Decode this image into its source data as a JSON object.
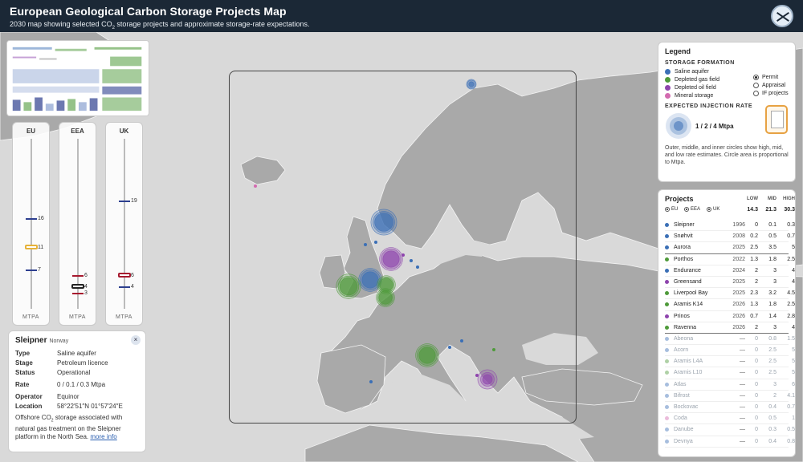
{
  "header": {
    "title": "European Geological Carbon Storage Projects Map",
    "subtitle_pre": "2030 map showing selected CO",
    "subtitle_sub": "2",
    "subtitle_post": " storage projects and approximate storage-rate expectations."
  },
  "sliders": [
    {
      "label": "EU",
      "footer": "MTPA",
      "values": {
        "high": "16",
        "mid": "11",
        "low": "7"
      },
      "levels": {
        "high": 16,
        "mid": 11,
        "low": 7
      },
      "color": "#2d3f8f",
      "mid_color": "#e6b23a"
    },
    {
      "label": "EEA",
      "footer": "MTPA",
      "values": {
        "high": "6",
        "mid": "4",
        "low": "3"
      },
      "levels": {
        "high": 6,
        "mid": 4,
        "low": 3
      },
      "color": "#a6192e",
      "mid_color": "#222222"
    },
    {
      "label": "UK",
      "footer": "MTPA",
      "values": {
        "high": "19",
        "mid": "6",
        "low": "4"
      },
      "levels": {
        "high": 19,
        "mid": 6,
        "low": 4
      },
      "color": "#2d3f8f",
      "mid_color": "#a6192e"
    }
  ],
  "slider_max": 30,
  "info": {
    "name": "Sleipner",
    "country": "Norway",
    "close": "×",
    "rows1": [
      {
        "k": "Type",
        "v": "Saline aquifer"
      },
      {
        "k": "Stage",
        "v": "Petroleum licence"
      },
      {
        "k": "Status",
        "v": "Operational"
      }
    ],
    "rate_k": "Rate",
    "rate_v": "0 / 0.1 / 0.3 Mtpa",
    "rows2": [
      {
        "k": "Operator",
        "v": "Equinor"
      },
      {
        "k": "Location",
        "v": "58°22′51″N 01°57′24″E"
      }
    ],
    "desc_pre": "Offshore CO",
    "desc_sub": "2",
    "desc_post": " storage associated with natural gas treatment on the Sleipner platform in the North Sea. ",
    "more": "more info"
  },
  "legend": {
    "title": "Legend",
    "formation_title": "STORAGE FORMATION",
    "formations": [
      {
        "label": "Saline aquifer",
        "color": "#3b6fb6"
      },
      {
        "label": "Depleted gas field",
        "color": "#4e9a3a"
      },
      {
        "label": "Depleted oil field",
        "color": "#8e44ad"
      },
      {
        "label": "Mineral storage",
        "color": "#d36bb0"
      }
    ],
    "stages": [
      {
        "label": "Permit",
        "on": true
      },
      {
        "label": "Appraisal",
        "on": false
      },
      {
        "label": "IF projects",
        "on": false
      }
    ],
    "rate_title": "EXPECTED INJECTION RATE",
    "rate_label": "1 / 2 / 4 Mtpa",
    "note": "Outer, middle, and inner circles show high, mid, and low rate estimates. Circle area is proportional to Mtpa."
  },
  "projects": {
    "title": "Projects",
    "cols": [
      "LOW",
      "MID",
      "HIGH"
    ],
    "filters": [
      "EU",
      "EEA",
      "UK"
    ],
    "totals": [
      "14.3",
      "21.3",
      "30.3"
    ],
    "rows": [
      {
        "name": "Sleipner",
        "year": "1996",
        "low": "0",
        "mid": "0.1",
        "high": "0.3",
        "color": "#3b6fb6",
        "faded": false,
        "sep": false
      },
      {
        "name": "Snøhvit",
        "year": "2008",
        "low": "0.2",
        "mid": "0.5",
        "high": "0.7",
        "color": "#3b6fb6",
        "faded": false,
        "sep": false
      },
      {
        "name": "Aurora",
        "year": "2025",
        "low": "2.5",
        "mid": "3.5",
        "high": "5",
        "color": "#3b6fb6",
        "faded": false,
        "sep": true
      },
      {
        "name": "Porthos",
        "year": "2022",
        "low": "1.3",
        "mid": "1.8",
        "high": "2.5",
        "color": "#4e9a3a",
        "faded": false,
        "sep": false
      },
      {
        "name": "Endurance",
        "year": "2024",
        "low": "2",
        "mid": "3",
        "high": "4",
        "color": "#3b6fb6",
        "faded": false,
        "sep": false
      },
      {
        "name": "Greensand",
        "year": "2025",
        "low": "2",
        "mid": "3",
        "high": "4",
        "color": "#8e44ad",
        "faded": false,
        "sep": false
      },
      {
        "name": "Liverpool Bay",
        "year": "2025",
        "low": "2.3",
        "mid": "3.2",
        "high": "4.5",
        "color": "#4e9a3a",
        "faded": false,
        "sep": false
      },
      {
        "name": "Aramis K14",
        "year": "2026",
        "low": "1.3",
        "mid": "1.8",
        "high": "2.5",
        "color": "#4e9a3a",
        "faded": false,
        "sep": false
      },
      {
        "name": "Prinos",
        "year": "2026",
        "low": "0.7",
        "mid": "1.4",
        "high": "2.8",
        "color": "#8e44ad",
        "faded": false,
        "sep": false
      },
      {
        "name": "Ravenna",
        "year": "2026",
        "low": "2",
        "mid": "3",
        "high": "4",
        "color": "#4e9a3a",
        "faded": false,
        "sep": true
      },
      {
        "name": "Abeona",
        "year": "—",
        "low": "0",
        "mid": "0.8",
        "high": "1.5",
        "color": "#3b6fb6",
        "faded": true,
        "sep": false
      },
      {
        "name": "Acorn",
        "year": "—",
        "low": "0",
        "mid": "2.5",
        "high": "5",
        "color": "#3b6fb6",
        "faded": true,
        "sep": false
      },
      {
        "name": "Aramis L4A",
        "year": "—",
        "low": "0",
        "mid": "2.5",
        "high": "5",
        "color": "#4e9a3a",
        "faded": true,
        "sep": false
      },
      {
        "name": "Aramis L10",
        "year": "—",
        "low": "0",
        "mid": "2.5",
        "high": "5",
        "color": "#4e9a3a",
        "faded": true,
        "sep": false
      },
      {
        "name": "Atlas",
        "year": "—",
        "low": "0",
        "mid": "3",
        "high": "6",
        "color": "#3b6fb6",
        "faded": true,
        "sep": false
      },
      {
        "name": "Bifrost",
        "year": "—",
        "low": "0",
        "mid": "2",
        "high": "4.1",
        "color": "#3b6fb6",
        "faded": true,
        "sep": false
      },
      {
        "name": "Bockovac",
        "year": "—",
        "low": "0",
        "mid": "0.4",
        "high": "0.7",
        "color": "#3b6fb6",
        "faded": true,
        "sep": false
      },
      {
        "name": "Coda",
        "year": "—",
        "low": "0",
        "mid": "0.5",
        "high": "1",
        "color": "#d36bb0",
        "faded": true,
        "sep": false
      },
      {
        "name": "Danube",
        "year": "—",
        "low": "0",
        "mid": "0.3",
        "high": "0.5",
        "color": "#3b6fb6",
        "faded": true,
        "sep": false
      },
      {
        "name": "Devnya",
        "year": "—",
        "low": "0",
        "mid": "0.4",
        "high": "0.8",
        "color": "#3b6fb6",
        "faded": true,
        "sep": false
      }
    ]
  },
  "map": {
    "land": "#a9a9a9",
    "sea": "#d9d9d9",
    "bubbles": [
      {
        "name": "Snøhvit",
        "color": "#3b6fb6",
        "high": 0.7,
        "mid": 0.5,
        "low": 0.2
      },
      {
        "name": "Aurora",
        "color": "#3b6fb6",
        "high": 5,
        "mid": 3.5,
        "low": 2.5
      },
      {
        "name": "Greensand",
        "color": "#8e44ad",
        "high": 4,
        "mid": 3,
        "low": 2
      },
      {
        "name": "Endurance",
        "color": "#3b6fb6",
        "high": 4,
        "mid": 3,
        "low": 2
      },
      {
        "name": "Liverpool Bay",
        "color": "#4e9a3a",
        "high": 4.5,
        "mid": 3.2,
        "low": 2.3
      },
      {
        "name": "Porthos",
        "color": "#4e9a3a",
        "high": 2.5,
        "mid": 1.8,
        "low": 1.3
      },
      {
        "name": "Aramis K14",
        "color": "#4e9a3a",
        "high": 2.5,
        "mid": 1.8,
        "low": 1.3
      },
      {
        "name": "Ravenna",
        "color": "#4e9a3a",
        "high": 4,
        "mid": 3,
        "low": 2
      },
      {
        "name": "Prinos",
        "color": "#8e44ad",
        "high": 2.8,
        "mid": 1.4,
        "low": 0.7
      }
    ]
  }
}
